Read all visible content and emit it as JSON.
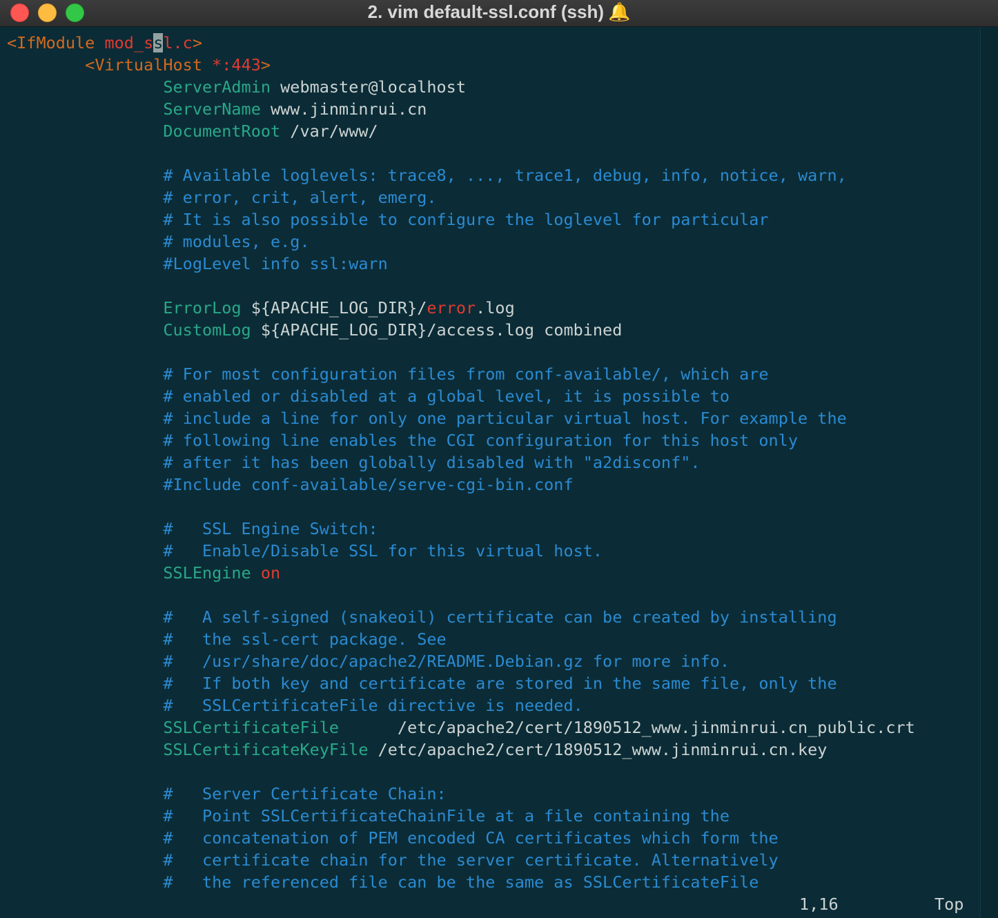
{
  "window": {
    "title": "2. vim default-ssl.conf (ssh)",
    "bell_icon": "bell-icon",
    "controls": [
      "close-button",
      "minimize-button",
      "zoom-button"
    ]
  },
  "colors": {
    "background": "#0b2c36",
    "tag": "#d4691f",
    "keyword": "#2aa889",
    "comment": "#2b8ad2",
    "error": "#e23a31",
    "text": "#cdd3d3"
  },
  "editor": {
    "lines": [
      {
        "segs": [
          {
            "t": "<IfModule ",
            "c": "tag"
          },
          {
            "t": "mod_s",
            "c": "red"
          },
          {
            "t": "s",
            "c": "cursor"
          },
          {
            "t": "l.c",
            "c": "red"
          },
          {
            "t": ">",
            "c": "tag"
          }
        ]
      },
      {
        "segs": [
          {
            "t": "        <VirtualHost ",
            "c": "tag"
          },
          {
            "t": "*",
            "c": "red"
          },
          {
            "t": ":443",
            "c": "red"
          },
          {
            "t": ">",
            "c": "tag"
          }
        ]
      },
      {
        "segs": [
          {
            "t": "                ServerAdmin",
            "c": "key"
          },
          {
            "t": " webmaster@localhost",
            "c": "plain"
          }
        ]
      },
      {
        "segs": [
          {
            "t": "                ServerName",
            "c": "key"
          },
          {
            "t": " www.jinminrui.cn",
            "c": "plain"
          }
        ]
      },
      {
        "segs": [
          {
            "t": "                DocumentRoot",
            "c": "key"
          },
          {
            "t": " /var/www/",
            "c": "plain"
          }
        ]
      },
      {
        "segs": []
      },
      {
        "segs": [
          {
            "t": "                # Available loglevels: trace8, ..., trace1, debug, info, notice, warn,",
            "c": "cmt"
          }
        ]
      },
      {
        "segs": [
          {
            "t": "                # error, crit, alert, emerg.",
            "c": "cmt"
          }
        ]
      },
      {
        "segs": [
          {
            "t": "                # It is also possible to configure the loglevel for particular",
            "c": "cmt"
          }
        ]
      },
      {
        "segs": [
          {
            "t": "                # modules, e.g.",
            "c": "cmt"
          }
        ]
      },
      {
        "segs": [
          {
            "t": "                #LogLevel info ssl:warn",
            "c": "cmt"
          }
        ]
      },
      {
        "segs": []
      },
      {
        "segs": [
          {
            "t": "                ErrorLog",
            "c": "key"
          },
          {
            "t": " ${APACHE_LOG_DIR}/",
            "c": "plain"
          },
          {
            "t": "error",
            "c": "red"
          },
          {
            "t": ".log",
            "c": "plain"
          }
        ]
      },
      {
        "segs": [
          {
            "t": "                CustomLog",
            "c": "key"
          },
          {
            "t": " ${APACHE_LOG_DIR}/access.log combined",
            "c": "plain"
          }
        ]
      },
      {
        "segs": []
      },
      {
        "segs": [
          {
            "t": "                # For most configuration files from conf-available/, which are",
            "c": "cmt"
          }
        ]
      },
      {
        "segs": [
          {
            "t": "                # enabled or disabled at a global level, it is possible to",
            "c": "cmt"
          }
        ]
      },
      {
        "segs": [
          {
            "t": "                # include a line for only one particular virtual host. For example the",
            "c": "cmt"
          }
        ]
      },
      {
        "segs": [
          {
            "t": "                # following line enables the CGI configuration for this host only",
            "c": "cmt"
          }
        ]
      },
      {
        "segs": [
          {
            "t": "                # after it has been globally disabled with \"a2disconf\".",
            "c": "cmt"
          }
        ]
      },
      {
        "segs": [
          {
            "t": "                #Include conf-available/serve-cgi-bin.conf",
            "c": "cmt"
          }
        ]
      },
      {
        "segs": []
      },
      {
        "segs": [
          {
            "t": "                #   SSL Engine Switch:",
            "c": "cmt"
          }
        ]
      },
      {
        "segs": [
          {
            "t": "                #   Enable/Disable SSL for this virtual host.",
            "c": "cmt"
          }
        ]
      },
      {
        "segs": [
          {
            "t": "                SSLEngine",
            "c": "key"
          },
          {
            "t": " ",
            "c": "plain"
          },
          {
            "t": "on",
            "c": "red"
          }
        ]
      },
      {
        "segs": []
      },
      {
        "segs": [
          {
            "t": "                #   A self-signed (snakeoil) certificate can be created by installing",
            "c": "cmt"
          }
        ]
      },
      {
        "segs": [
          {
            "t": "                #   the ssl-cert package. See",
            "c": "cmt"
          }
        ]
      },
      {
        "segs": [
          {
            "t": "                #   /usr/share/doc/apache2/README.Debian.gz for more info.",
            "c": "cmt"
          }
        ]
      },
      {
        "segs": [
          {
            "t": "                #   If both key and certificate are stored in the same file, only the",
            "c": "cmt"
          }
        ]
      },
      {
        "segs": [
          {
            "t": "                #   SSLCertificateFile directive is needed.",
            "c": "cmt"
          }
        ]
      },
      {
        "segs": [
          {
            "t": "                SSLCertificateFile",
            "c": "key"
          },
          {
            "t": "      /etc/apache2/cert/1890512_www.jinminrui.cn_public.crt",
            "c": "plain"
          }
        ]
      },
      {
        "segs": [
          {
            "t": "                SSLCertificateKeyFile",
            "c": "key"
          },
          {
            "t": " /etc/apache2/cert/1890512_www.jinminrui.cn.key",
            "c": "plain"
          }
        ]
      },
      {
        "segs": []
      },
      {
        "segs": [
          {
            "t": "                #   Server Certificate Chain:",
            "c": "cmt"
          }
        ]
      },
      {
        "segs": [
          {
            "t": "                #   Point SSLCertificateChainFile at a file containing the",
            "c": "cmt"
          }
        ]
      },
      {
        "segs": [
          {
            "t": "                #   concatenation of PEM encoded CA certificates which form the",
            "c": "cmt"
          }
        ]
      },
      {
        "segs": [
          {
            "t": "                #   certificate chain for the server certificate. Alternatively",
            "c": "cmt"
          }
        ]
      },
      {
        "segs": [
          {
            "t": "                #   the referenced file can be the same as SSLCertificateFile",
            "c": "cmt"
          }
        ]
      }
    ]
  },
  "statusline": {
    "position": "1,16",
    "scroll": "Top"
  }
}
